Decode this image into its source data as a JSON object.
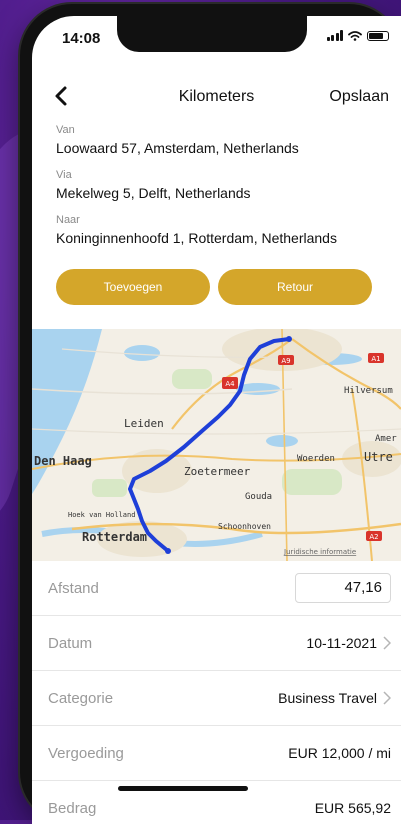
{
  "status_bar": {
    "time": "14:08"
  },
  "nav": {
    "title": "Kilometers",
    "save_label": "Opslaan"
  },
  "route": {
    "from": {
      "label": "Van",
      "value": "Loowaard 57, Amsterdam, Netherlands"
    },
    "via": {
      "label": "Via",
      "value": "Mekelweg 5, Delft, Netherlands"
    },
    "to": {
      "label": "Naar",
      "value": "Koninginnenhoofd 1, Rotterdam, Netherlands"
    }
  },
  "buttons": {
    "add": "Toevoegen",
    "return": "Retour"
  },
  "map": {
    "places": {
      "leiden": "Leiden",
      "den_haag": "Den Haag",
      "zoetermeer": "Zoetermeer",
      "woerden": "Woerden",
      "utrecht": "Utre",
      "gouda": "Gouda",
      "hilversum": "Hilversum",
      "amersfoort": "Amer",
      "hoek_van_holland": "Hoek van Holland",
      "rotterdam": "Rotterdam",
      "schoonhoven": "Schoonhoven"
    },
    "road_badges": {
      "a9": "A9",
      "a1": "A1",
      "a4": "A4",
      "a2": "A2"
    },
    "legal": "Juridische informatie",
    "route_color": "#1e3fd8"
  },
  "details": {
    "distance": {
      "label": "Afstand",
      "value": "47,16"
    },
    "date": {
      "label": "Datum",
      "value": "10-11-2021"
    },
    "category": {
      "label": "Categorie",
      "value": "Business Travel"
    },
    "compensation": {
      "label": "Vergoeding",
      "value": "EUR 12,000 / mi"
    },
    "amount": {
      "label": "Bedrag",
      "value": "EUR 565,92"
    }
  },
  "colors": {
    "accent": "#d4a62a"
  }
}
